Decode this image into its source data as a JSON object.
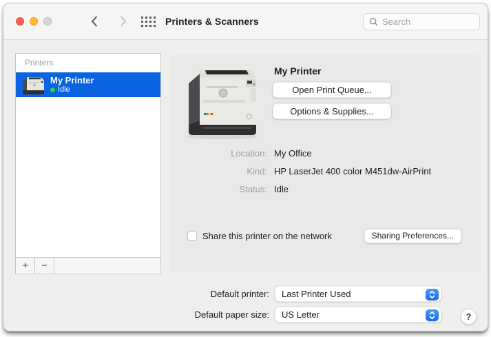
{
  "titlebar": {
    "title": "Printers & Scanners",
    "search_placeholder": "Search"
  },
  "sidebar": {
    "header": "Printers",
    "items": [
      {
        "name": "My Printer",
        "status": "Idle"
      }
    ],
    "add_button": "+",
    "remove_button": "−"
  },
  "detail": {
    "printer_name": "My Printer",
    "open_print_queue_button": "Open Print Queue...",
    "options_supplies_button": "Options & Supplies...",
    "info": [
      {
        "label": "Location:",
        "value": "My Office"
      },
      {
        "label": "Kind:",
        "value": "HP LaserJet 400 color M451dw-AirPrint"
      },
      {
        "label": "Status:",
        "value": "Idle"
      }
    ],
    "share_checkbox_label": "Share this printer on the network",
    "share_checked": false,
    "sharing_preferences_button": "Sharing Preferences..."
  },
  "footer": {
    "default_printer_label": "Default printer:",
    "default_printer_value": "Last Printer Used",
    "default_paper_label": "Default paper size:",
    "default_paper_value": "US Letter",
    "help_button": "?"
  },
  "icons": {
    "traffic_lights": [
      "close-red-circle",
      "minimize-yellow-circle",
      "zoom-gray-circle"
    ],
    "back": "chevron-left",
    "forward": "chevron-right",
    "app_grid": "dot-grid",
    "search": "magnifier",
    "status_dot": "green-dot",
    "popup_control": "up-down-chevrons"
  },
  "colors": {
    "selection_blue": "#0a64e1",
    "accent_blue": "#1a67ee",
    "status_green": "#2fd14f",
    "traffic_red": "#ff5f57",
    "traffic_yellow": "#febc2f",
    "traffic_gray": "#d9d8d6",
    "panel_gray": "#e9e9e7"
  }
}
